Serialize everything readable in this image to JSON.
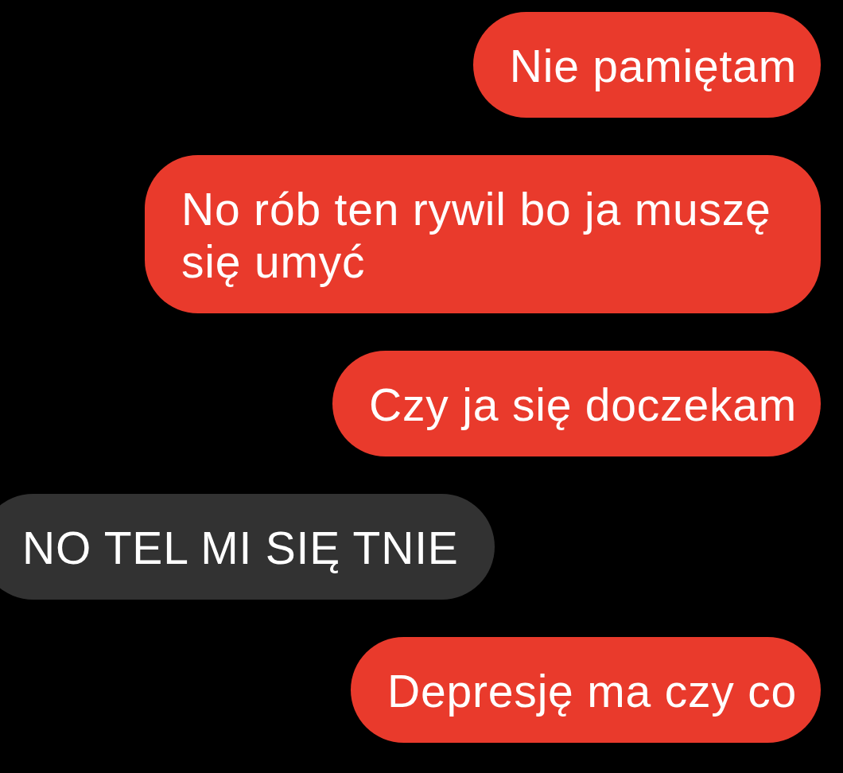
{
  "messages": [
    {
      "kind": "sent",
      "text": "Nie pamiętam"
    },
    {
      "kind": "sent",
      "text": "No rób ten rywil bo ja muszę się umyć"
    },
    {
      "kind": "sent",
      "text": "Czy ja się doczekam"
    },
    {
      "kind": "received",
      "text": "NO TEL MI SIĘ TNIE"
    },
    {
      "kind": "sent",
      "text": "Depresję ma czy co"
    }
  ]
}
